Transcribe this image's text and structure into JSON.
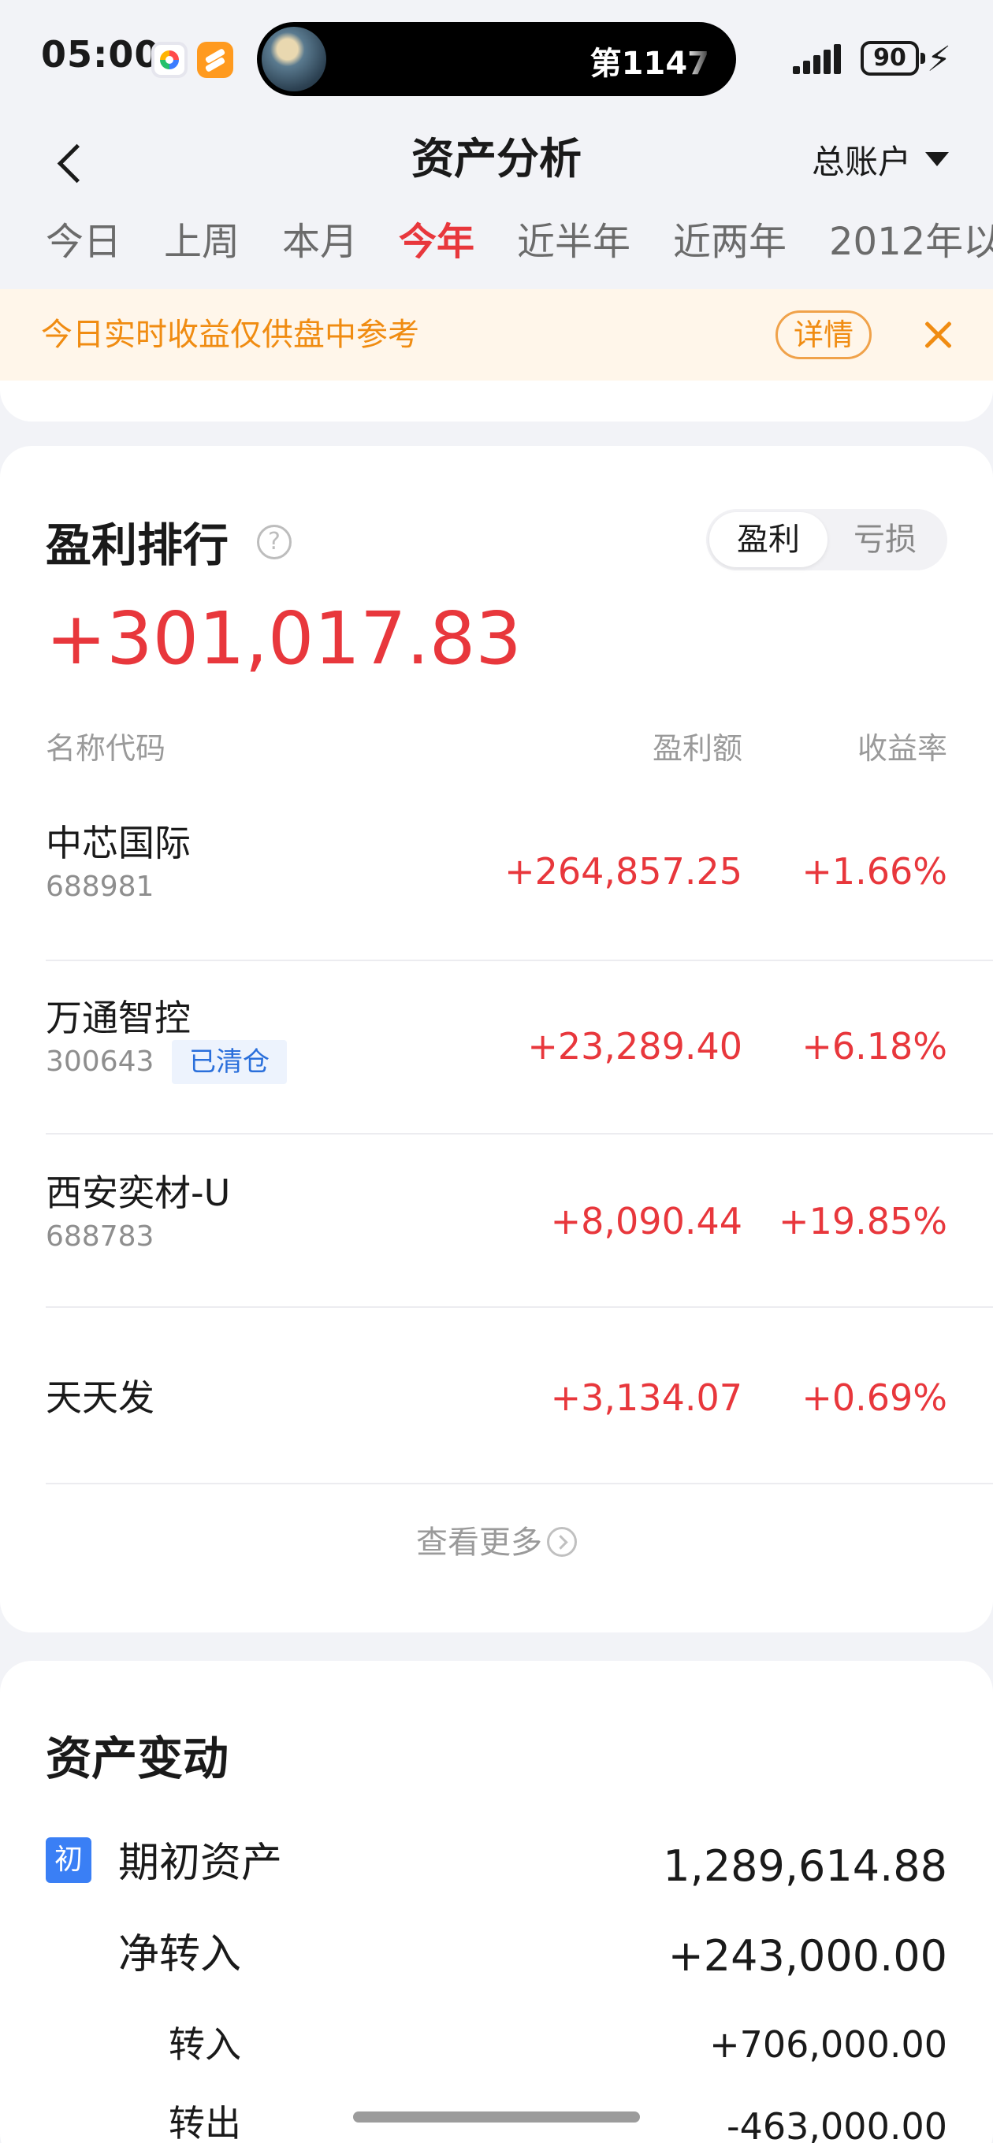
{
  "status_bar": {
    "time": "05:00",
    "island_text": "第1147",
    "battery": "90",
    "icons": [
      "app-icon-1",
      "app-icon-2",
      "signal-icon",
      "battery-icon",
      "charging-icon"
    ]
  },
  "nav": {
    "title": "资产分析",
    "account_label": "总账户"
  },
  "tabs": [
    "今日",
    "上周",
    "本月",
    "今年",
    "近半年",
    "近两年",
    "2012年以"
  ],
  "active_tab": "今年",
  "notice": {
    "text": "今日实时收益仅供盘中参考",
    "detail_label": "详情"
  },
  "profit_ranking": {
    "title": "盈利排行",
    "help_icon": "?",
    "toggle": [
      "盈利",
      "亏损"
    ],
    "total": "+301,017.83",
    "headers": {
      "name": "名称代码",
      "amount": "盈利额",
      "rate": "收益率"
    },
    "rows": [
      {
        "name": "中芯国际",
        "code": "688981",
        "tag": "",
        "amount": "+264,857.25",
        "rate": "+1.66%"
      },
      {
        "name": "万通智控",
        "code": "300643",
        "tag": "已清仓",
        "amount": "+23,289.40",
        "rate": "+6.18%"
      },
      {
        "name": "西安奕材-U",
        "code": "688783",
        "tag": "",
        "amount": "+8,090.44",
        "rate": "+19.85%"
      },
      {
        "name": "天天发",
        "code": "",
        "tag": "",
        "amount": "+3,134.07",
        "rate": "+0.69%"
      }
    ],
    "more_label": "查看更多"
  },
  "asset_change": {
    "title": "资产变动",
    "badge": "初",
    "items": [
      {
        "label": "期初资产",
        "value": "1,289,614.88"
      },
      {
        "label": "净转入",
        "value": "+243,000.00"
      },
      {
        "label": "转入",
        "value": "+706,000.00"
      },
      {
        "label": "转出",
        "value": "-463,000.00"
      }
    ]
  },
  "colors": {
    "accent_red": "#e8373c",
    "notice_orange": "#f08c12",
    "tag_blue": "#2a6fdb",
    "badge_blue": "#3a7ff5"
  }
}
